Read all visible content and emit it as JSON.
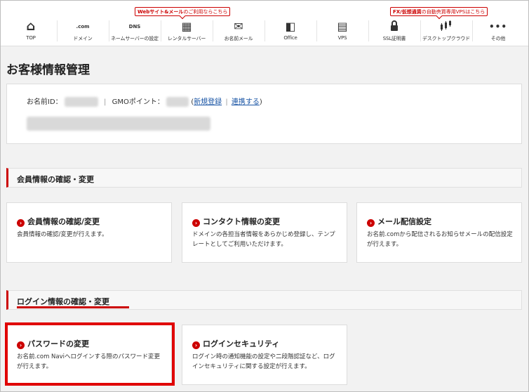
{
  "nav": {
    "items": [
      {
        "label": "TOP",
        "icon": "home-icon",
        "glyph": "⌂"
      },
      {
        "label": "ドメイン",
        "icon": "domain-icon",
        "glyph": ".com"
      },
      {
        "label": "ネームサーバーの設定",
        "icon": "dns-icon",
        "glyph": "DNS"
      },
      {
        "label": "レンタルサーバー",
        "icon": "server-icon",
        "glyph": "▦"
      },
      {
        "label": "お名前メール",
        "icon": "mail-icon",
        "glyph": "✉"
      },
      {
        "label": "Office",
        "icon": "office-icon",
        "glyph": "◧"
      },
      {
        "label": "VPS",
        "icon": "vps-icon",
        "glyph": "▤"
      },
      {
        "label": "SSL証明書",
        "icon": "lock-icon",
        "glyph": "🔒"
      },
      {
        "label": "デスクトップクラウド",
        "icon": "chart-icon",
        "glyph": "⫶"
      },
      {
        "label": "その他",
        "icon": "more-icon",
        "glyph": "•••"
      }
    ],
    "promo_server": {
      "bold": "Webサイト&メール",
      "text": "のご利用ならこちら"
    },
    "promo_fx": {
      "bold": "FX/仮想通貨",
      "text": "の自動売買専用VPSはこちら"
    }
  },
  "page_title": "お客様情報管理",
  "account": {
    "id_label": "お名前ID：",
    "points_label": "GMOポイント：",
    "register_link": "新規登録",
    "link_link": "連携する",
    "open_paren": "(",
    "close_paren": ")",
    "divider": "|"
  },
  "sections": {
    "member": {
      "title": "会員情報の確認・変更",
      "cards": [
        {
          "title": "会員情報の確認/変更",
          "desc": "会員情報の確認/変更が行えます。"
        },
        {
          "title": "コンタクト情報の変更",
          "desc": "ドメインの各担当者情報をあらかじめ登録し、テンプレートとしてご利用いただけます。"
        },
        {
          "title": "メール配信設定",
          "desc": "お名前.comから配信されるお知らせメールの配信設定が行えます。"
        }
      ]
    },
    "login": {
      "title": "ログイン情報の確認・変更",
      "cards": [
        {
          "title": "パスワードの変更",
          "desc": "お名前.com Naviへログインする際のパスワード変更が行えます。"
        },
        {
          "title": "ログインセキュリティ",
          "desc": "ログイン時の通知機能の設定や二段階認証など、ログインセキュリティに関する設定が行えます。"
        }
      ]
    }
  },
  "colors": {
    "accent": "#cc0000",
    "link": "#1a55a5",
    "highlight": "#e00000"
  }
}
